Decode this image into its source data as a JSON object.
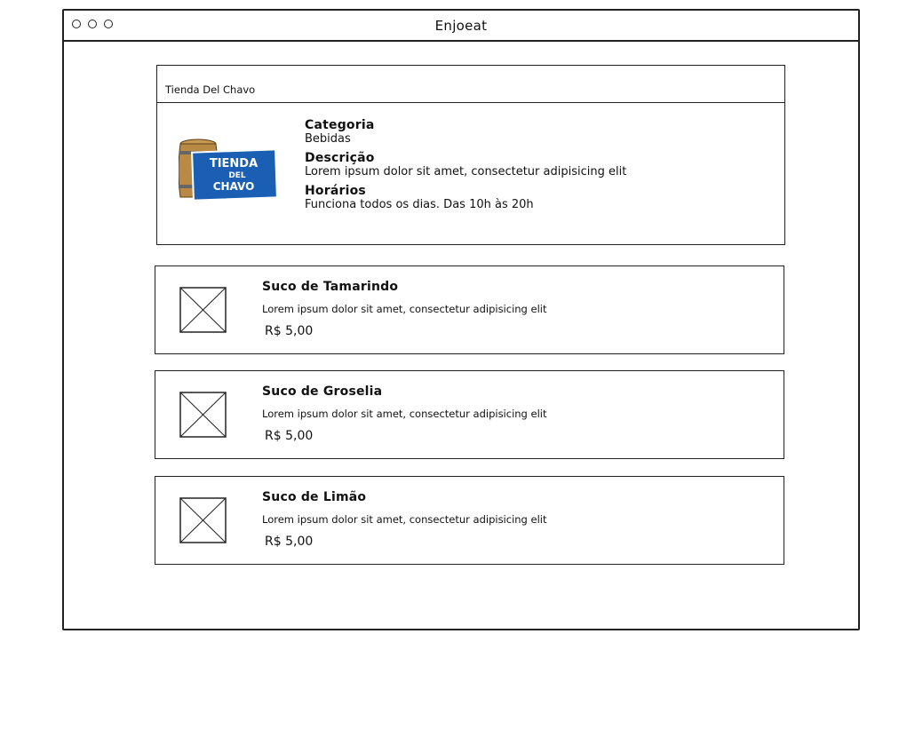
{
  "window": {
    "title": "Enjoeat"
  },
  "store": {
    "name": "Tienda Del Chavo",
    "logo_text": [
      "TIENDA",
      "DEL",
      "CHAVO"
    ],
    "category_label": "Categoria",
    "category_value": "Bebidas",
    "description_label": "Descrição",
    "description_value": "Lorem ipsum dolor sit amet, consectetur adipisicing elit",
    "hours_label": "Horários",
    "hours_value": "Funciona todos os dias. Das 10h às 20h"
  },
  "products": [
    {
      "name": "Suco de Tamarindo",
      "description": "Lorem ipsum dolor sit amet, consectetur adipisicing elit",
      "price": "R$ 5,00"
    },
    {
      "name": "Suco de Groselia",
      "description": "Lorem ipsum dolor sit amet, consectetur adipisicing elit",
      "price": "R$ 5,00"
    },
    {
      "name": "Suco de Limão",
      "description": "Lorem ipsum dolor sit amet, consectetur adipisicing elit",
      "price": "R$ 5,00"
    }
  ],
  "colors": {
    "logo_blue": "#1a5fb4",
    "barrel_brown": "#b98a45"
  }
}
